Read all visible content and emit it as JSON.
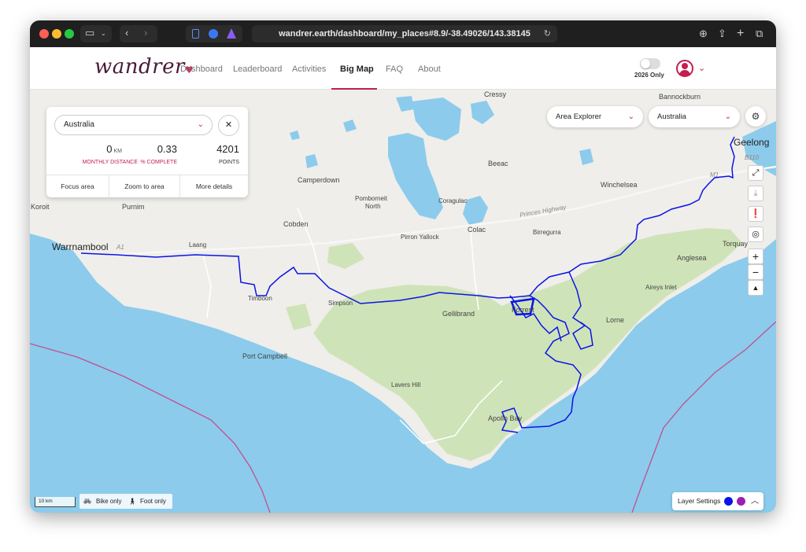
{
  "browser": {
    "url": "wandrer.earth/dashboard/my_places#8.9/-38.49026/143.38145"
  },
  "app": {
    "logo": "wandrer",
    "nav": [
      {
        "label": "Dashboard"
      },
      {
        "label": "Leaderboard"
      },
      {
        "label": "Activities"
      },
      {
        "label": "Big Map",
        "active": true
      },
      {
        "label": "FAQ"
      },
      {
        "label": "About"
      }
    ],
    "toggle_label": "2026 Only",
    "accent_color": "#c41f4e"
  },
  "area_card": {
    "selected_area": "Australia",
    "stats": {
      "monthly_distance": {
        "value": "0",
        "unit": "KM",
        "label": "MONTHLY DISTANCE"
      },
      "percent_complete": {
        "value": "0.33",
        "label": "% COMPLETE"
      },
      "points": {
        "value": "4201",
        "label": "POINTS"
      }
    },
    "actions": {
      "focus": "Focus area",
      "zoom": "Zoom to area",
      "details": "More details"
    }
  },
  "map_controls": {
    "explorer_dropdown": "Area Explorer",
    "region_dropdown": "Australia",
    "scale_label": "10 km",
    "bike_filter": "Bike only",
    "foot_filter": "Foot only",
    "layer_settings": "Layer Settings",
    "layer_colors": [
      "#0a14e6",
      "#9b1fb5"
    ]
  },
  "map_labels": {
    "warrnambool": "Warrnambool",
    "geelong": "Geelong",
    "cressy": "Cressy",
    "bannockburn": "Bannockburn",
    "camperdown": "Camperdown",
    "beeac": "Beeac",
    "winchelsea": "Winchelsea",
    "koroit": "Koroit",
    "purnim": "Purnim",
    "pomborneit": "Pomborneit",
    "north": "North",
    "coragulac": "Coragulac",
    "cobden": "Cobden",
    "pirron": "Pirron Yallock",
    "colac": "Colac",
    "birregurra": "Birregurra",
    "torquay": "Torquay",
    "laang": "Laang",
    "anglesea": "Anglesea",
    "timboon": "Timboon",
    "simpson": "Simpson",
    "gellibrand": "Gellibrand",
    "forrest": "Forrest",
    "aireys": "Aireys Inlet",
    "lorne": "Lorne",
    "portcampbell": "Port Campbell",
    "lavers": "Lavers Hill",
    "apollo": "Apollo Bay",
    "princes": "Princes Highway",
    "m1": "M1",
    "b110": "B110",
    "a1": "A1"
  }
}
